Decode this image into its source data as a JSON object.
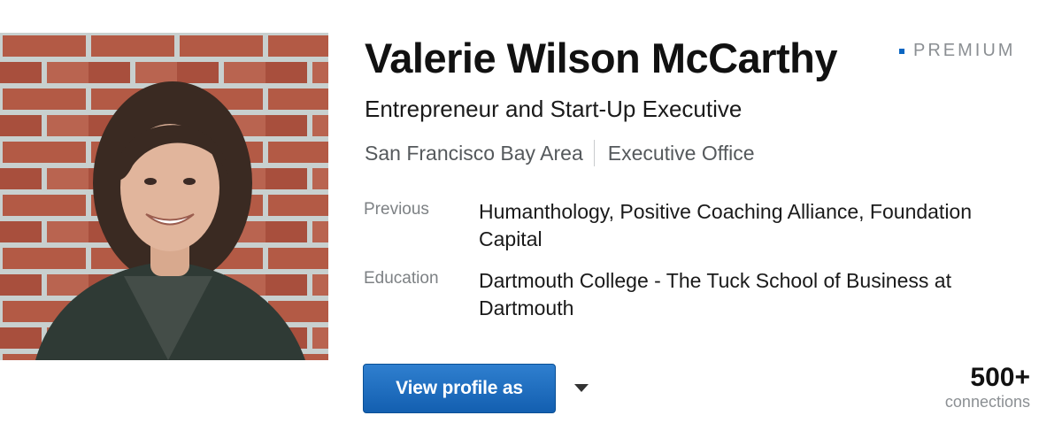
{
  "profile": {
    "photo_alt": "Profile photo",
    "name": "Valerie Wilson McCarthy",
    "badge": "PREMIUM",
    "headline": "Entrepreneur and Start-Up Executive",
    "location": "San Francisco Bay Area",
    "industry": "Executive Office",
    "details": [
      {
        "label": "Previous",
        "value": "Humanthology, Positive Coaching Alliance, Foundation Capital"
      },
      {
        "label": "Education",
        "value": "Dartmouth College - The Tuck School of Business at Dartmouth"
      }
    ]
  },
  "actions": {
    "view_profile_label": "View profile as",
    "dropdown_icon": "caret-down-icon"
  },
  "connections": {
    "count": "500+",
    "label": "connections"
  },
  "colors": {
    "button_blue": "#135fb0",
    "premium_accent": "#0b66c2",
    "muted_text": "#7d8184"
  }
}
